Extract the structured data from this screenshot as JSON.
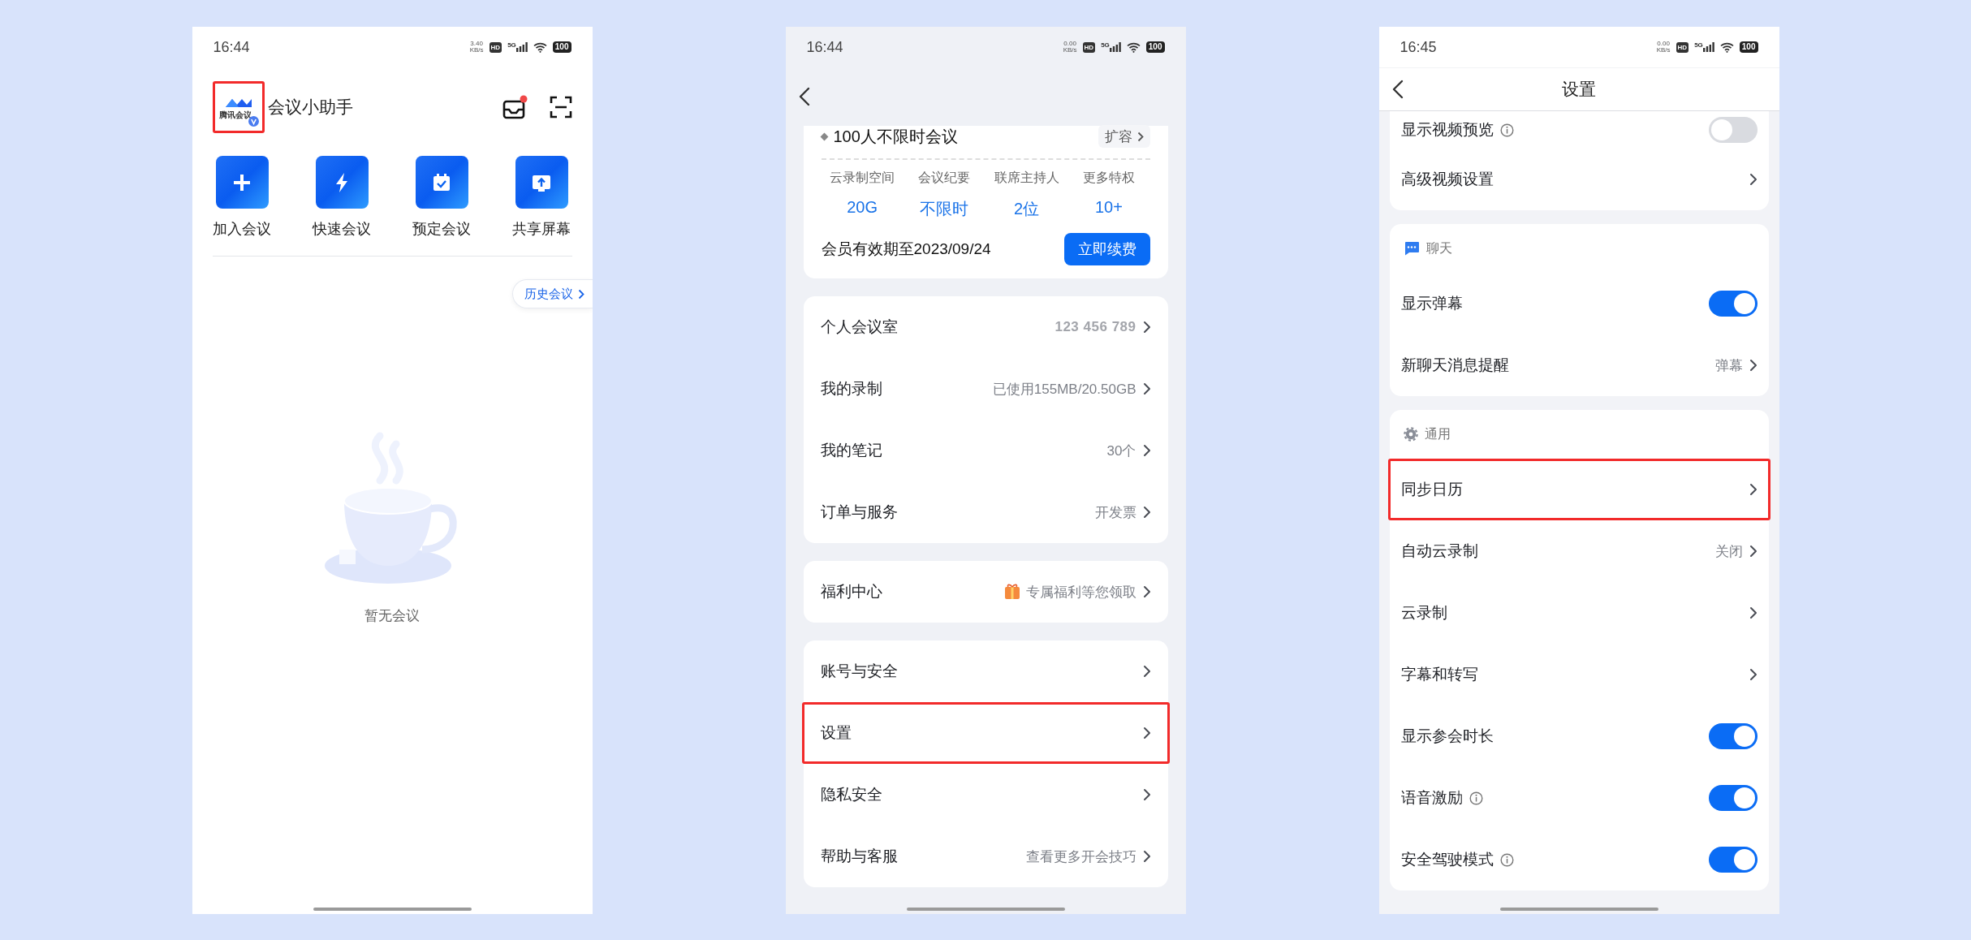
{
  "home_screen": {
    "status_bar": {
      "time": "16:44",
      "speed": "3.40",
      "speed_unit": "KB/s",
      "hd": "HD",
      "network": "5G",
      "battery": "100"
    },
    "header": {
      "logo_text": "腾讯会议",
      "logo_highlighted": true,
      "title": "会议小助手",
      "inbox_unread": true
    },
    "actions": [
      {
        "kind": "join",
        "label": "加入会议"
      },
      {
        "kind": "quick",
        "label": "快速会议"
      },
      {
        "kind": "schedule",
        "label": "预定会议"
      },
      {
        "kind": "share",
        "label": "共享屏幕"
      }
    ],
    "history_button": "历史会议",
    "empty_text": "暂无会议"
  },
  "profile_screen": {
    "status_bar": {
      "time": "16:44",
      "speed": "0.00",
      "speed_unit": "KB/s",
      "hd": "HD",
      "network": "5G",
      "battery": "100"
    },
    "plan": {
      "name": "100人不限时会议",
      "action": "扩容"
    },
    "stats": [
      {
        "label": "云录制空间",
        "value": "20G"
      },
      {
        "label": "会议纪要",
        "value": "不限时"
      },
      {
        "label": "联席主持人",
        "value": "2位"
      },
      {
        "label": "更多特权",
        "value": "10+"
      }
    ],
    "expiry": "会员有效期至2023/09/24",
    "renew_button": "立即续费",
    "groups": [
      [
        {
          "kind": "link",
          "label": "个人会议室",
          "value": "123 456 789",
          "highlighted": false
        },
        {
          "kind": "link",
          "label": "我的录制",
          "value": "已使用155MB/20.50GB",
          "highlighted": false
        },
        {
          "kind": "link",
          "label": "我的笔记",
          "value": "30个",
          "highlighted": false
        },
        {
          "kind": "link",
          "label": "订单与服务",
          "value": "开发票",
          "highlighted": false
        }
      ],
      [
        {
          "kind": "promo",
          "label": "福利中心",
          "value": "专属福利等您领取",
          "highlighted": false
        }
      ],
      [
        {
          "kind": "link",
          "label": "账号与安全",
          "highlighted": false
        },
        {
          "kind": "link",
          "label": "设置",
          "highlighted": true
        },
        {
          "kind": "link",
          "label": "隐私安全",
          "highlighted": false
        },
        {
          "kind": "link",
          "label": "帮助与客服",
          "value": "查看更多开会技巧",
          "highlighted": false
        }
      ]
    ]
  },
  "settings_screen": {
    "status_bar": {
      "time": "16:45",
      "speed": "0.00",
      "speed_unit": "KB/s",
      "hd": "HD",
      "network": "5G",
      "battery": "100"
    },
    "title": "设置",
    "groups": [
      {
        "rows": [
          {
            "kind": "toggle",
            "label": "显示视频预览",
            "info": true,
            "on": false,
            "highlighted": false
          },
          {
            "kind": "link",
            "label": "高级视频设置",
            "info": false,
            "highlighted": false
          }
        ]
      },
      {
        "section": {
          "kind": "chat",
          "label": "聊天"
        },
        "rows": [
          {
            "kind": "toggle",
            "label": "显示弹幕",
            "info": false,
            "on": true,
            "highlighted": false
          },
          {
            "kind": "link",
            "label": "新聊天消息提醒",
            "value": "弹幕",
            "info": false,
            "highlighted": false
          }
        ]
      },
      {
        "section": {
          "kind": "general",
          "label": "通用"
        },
        "rows": [
          {
            "kind": "link",
            "label": "同步日历",
            "info": false,
            "highlighted": true
          },
          {
            "kind": "link",
            "label": "自动云录制",
            "value": "关闭",
            "info": false,
            "highlighted": false
          },
          {
            "kind": "link",
            "label": "云录制",
            "info": false,
            "highlighted": false
          },
          {
            "kind": "link",
            "label": "字幕和转写",
            "info": false,
            "highlighted": false
          },
          {
            "kind": "toggle",
            "label": "显示参会时长",
            "info": false,
            "on": true,
            "highlighted": false
          },
          {
            "kind": "toggle",
            "label": "语音激励",
            "info": true,
            "on": true,
            "highlighted": false
          },
          {
            "kind": "toggle",
            "label": "安全驾驶模式",
            "info": true,
            "on": true,
            "highlighted": false
          }
        ]
      }
    ]
  }
}
